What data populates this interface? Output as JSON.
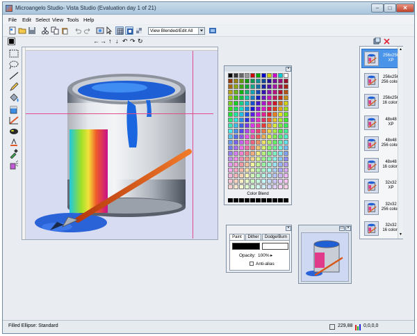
{
  "window": {
    "title": "Microangelo Studio- Vista Studio  (Evaluation day 1 of 21)",
    "controls": {
      "minimize": "–",
      "maximize": "□",
      "close": "✕"
    }
  },
  "menu": [
    "File",
    "Edit",
    "Select",
    "View",
    "Tools",
    "Help"
  ],
  "toolbar": {
    "view_mode": "View Blended/Edit All"
  },
  "nudge_arrows": [
    "←",
    "→",
    "↑",
    "↓",
    "↶",
    "↷",
    "↻"
  ],
  "tools": [
    "selection-rect-icon",
    "lasso-icon",
    "line-icon",
    "pencil-icon",
    "fill-bucket-icon",
    "paint-can-icon",
    "gradient-icon",
    "ellipse-icon",
    "text-icon",
    "eyedropper-icon",
    "spray-icon"
  ],
  "palette": {
    "label": "Color Blend"
  },
  "paint_panel": {
    "tabs": [
      "Paint",
      "Dither",
      "Dodge/Burn"
    ],
    "opacity_label": "Opacity:",
    "opacity_value": "100%",
    "antialias_label": "Anti-alias"
  },
  "formats": [
    {
      "size": "256x256",
      "depth": "XP",
      "selected": true
    },
    {
      "size": "256x256",
      "depth": "256 colors",
      "selected": false
    },
    {
      "size": "256x256",
      "depth": "16 colors",
      "selected": false
    },
    {
      "size": "48x48",
      "depth": "XP",
      "selected": false
    },
    {
      "size": "48x48",
      "depth": "256 colors",
      "selected": false
    },
    {
      "size": "48x48",
      "depth": "16 colors",
      "selected": false
    },
    {
      "size": "32x32",
      "depth": "XP",
      "selected": false
    },
    {
      "size": "32x32",
      "depth": "256 colors",
      "selected": false
    },
    {
      "size": "32x32",
      "depth": "16 colors",
      "selected": false
    }
  ],
  "status": {
    "tool": "Filled Ellipse: Standard",
    "cursor": "229,88",
    "color": "0,0,0,0"
  },
  "colors": {
    "accent": "#4a95e9",
    "guide": "#e04b8a",
    "canvas_bg": "#d8dcf2"
  }
}
